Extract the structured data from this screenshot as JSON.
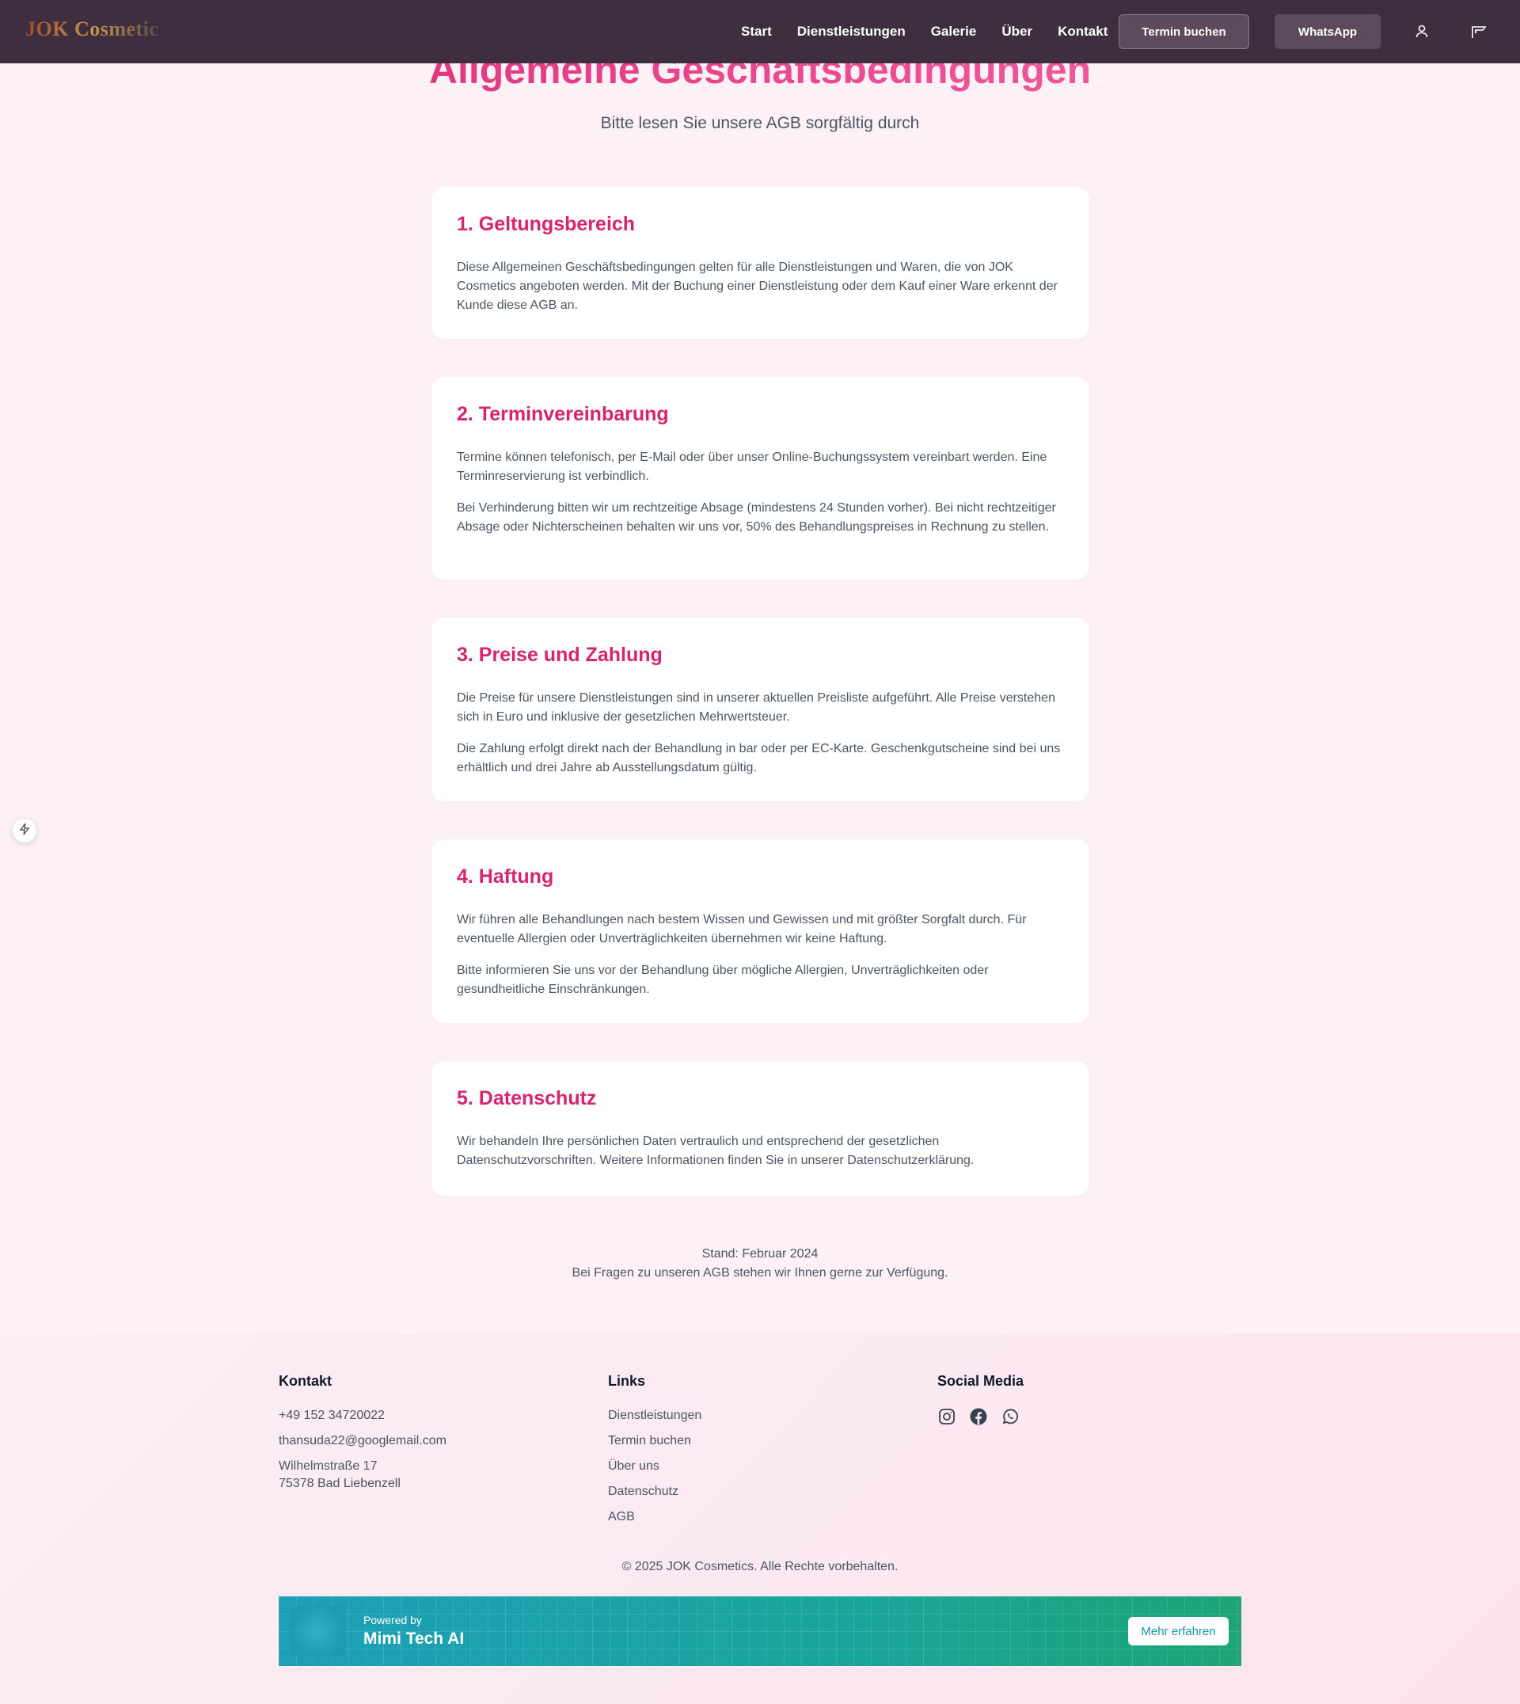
{
  "header": {
    "logo": "JOK Cosmetic",
    "nav": [
      "Start",
      "Dienstleistungen",
      "Galerie",
      "Über",
      "Kontakt"
    ],
    "termin_button": "Termin buchen",
    "whatsapp_button": "WhatsApp"
  },
  "main": {
    "title": "Allgemeine Geschäftsbedingungen",
    "subtitle": "Bitte lesen Sie unsere AGB sorgfältig durch",
    "sections": [
      {
        "heading": "1. Geltungsbereich",
        "paragraphs": [
          "Diese Allgemeinen Geschäftsbedingungen gelten für alle Dienstleistungen und Waren, die von JOK Cosmetics angeboten werden. Mit der Buchung einer Dienstleistung oder dem Kauf einer Ware erkennt der Kunde diese AGB an."
        ]
      },
      {
        "heading": "2. Terminvereinbarung",
        "paragraphs": [
          "Termine können telefonisch, per E-Mail oder über unser Online-Buchungssystem vereinbart werden. Eine Terminreservierung ist verbindlich.",
          "Bei Verhinderung bitten wir um rechtzeitige Absage (mindestens 24 Stunden vorher). Bei nicht rechtzeitiger Absage oder Nichterscheinen behalten wir uns vor, 50% des Behandlungspreises in Rechnung zu stellen."
        ]
      },
      {
        "heading": "3. Preise und Zahlung",
        "paragraphs": [
          "Die Preise für unsere Dienstleistungen sind in unserer aktuellen Preisliste aufgeführt. Alle Preise verstehen sich in Euro und inklusive der gesetzlichen Mehrwertsteuer.",
          "Die Zahlung erfolgt direkt nach der Behandlung in bar oder per EC-Karte. Geschenkgutscheine sind bei uns erhältlich und drei Jahre ab Ausstellungsdatum gültig."
        ]
      },
      {
        "heading": "4. Haftung",
        "paragraphs": [
          "Wir führen alle Behandlungen nach bestem Wissen und Gewissen und mit größter Sorgfalt durch. Für eventuelle Allergien oder Unverträglichkeiten übernehmen wir keine Haftung.",
          "Bitte informieren Sie uns vor der Behandlung über mögliche Allergien, Unverträglichkeiten oder gesundheitliche Einschränkungen."
        ]
      },
      {
        "heading": "5. Datenschutz",
        "paragraphs": [
          "Wir behandeln Ihre persönlichen Daten vertraulich und entsprechend der gesetzlichen Datenschutzvorschriften. Weitere Informationen finden Sie in unserer Datenschutzerklärung."
        ]
      }
    ],
    "stand": "Stand: Februar 2024",
    "questions": "Bei Fragen zu unseren AGB stehen wir Ihnen gerne zur Verfügung."
  },
  "footer": {
    "contact_heading": "Kontakt",
    "phone": "+49 152 34720022",
    "email": "thansuda22@googlemail.com",
    "street": "Wilhelmstraße 17",
    "city": "75378 Bad Liebenzell",
    "links_heading": "Links",
    "links": [
      "Dienstleistungen",
      "Termin buchen",
      "Über uns",
      "Datenschutz",
      "AGB"
    ],
    "social_heading": "Social Media",
    "social_icons": [
      "instagram-icon",
      "facebook-icon",
      "whatsapp-icon"
    ],
    "copyright": "© 2025 JOK Cosmetics. Alle Rechte vorbehalten.",
    "banner": {
      "powered_by": "Powered by",
      "brand": "Mimi Tech AI",
      "button": "Mehr erfahren"
    }
  },
  "colors": {
    "header_bg": "#3f2d40",
    "accent": "#d6246e",
    "page_bg": "#fdf1f6",
    "banner_start": "#1d9fb8",
    "banner_end": "#1ea476"
  }
}
